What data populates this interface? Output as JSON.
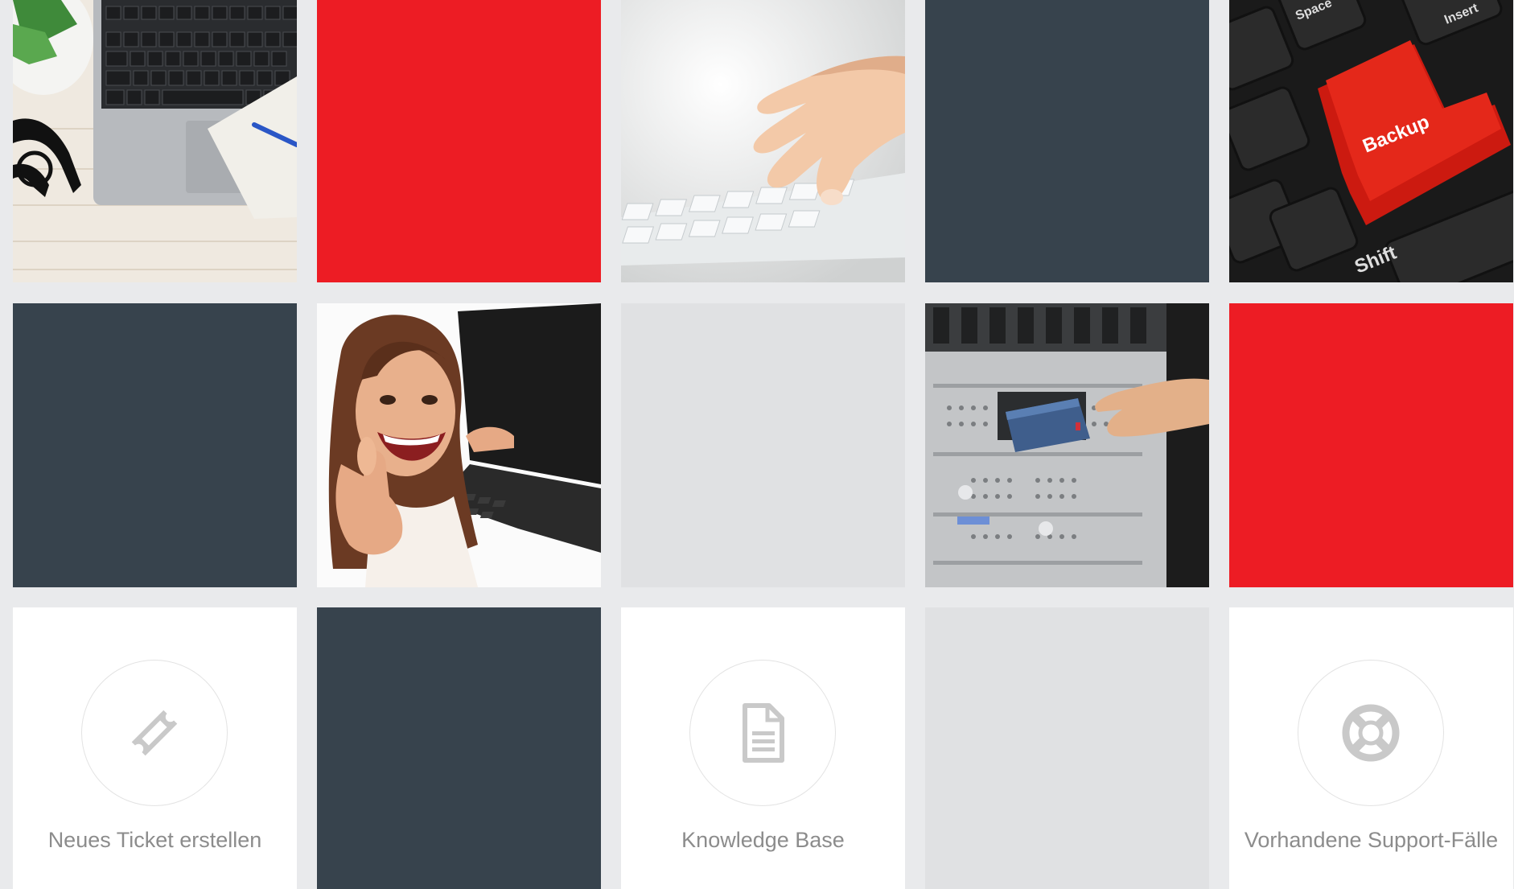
{
  "colors": {
    "page_background": "#e9eaec",
    "red": "#ed1c24",
    "dark": "#37434d",
    "light": "#e0e1e3",
    "white": "#ffffff",
    "label_gray": "#8c8c8c",
    "icon_gray": "#c9c9c9"
  },
  "tiles": {
    "photo_laptop_desk": {
      "kind": "photo",
      "subject": "laptop on wooden desk with plant, glasses and notepad"
    },
    "photo_hand_keyboard": {
      "kind": "photo",
      "subject": "hand typing on white keyboard"
    },
    "photo_backup_key": {
      "kind": "photo",
      "subject": "keyboard with red backup key",
      "key_text": "Backup",
      "shift_text": "Shift",
      "space_text": "Space",
      "insert_text": "Insert"
    },
    "photo_happy_user": {
      "kind": "photo",
      "subject": "smiling woman with laptop giving thumbs up"
    },
    "photo_server_rack": {
      "kind": "photo",
      "subject": "hand inserting tape cartridge into server rack"
    }
  },
  "actions": {
    "new_ticket": {
      "label": "Neues Ticket erstellen",
      "icon": "ticket-icon"
    },
    "knowledge_base": {
      "label": "Knowledge Base",
      "icon": "document-icon"
    },
    "support_cases": {
      "label": "Vorhandene Support-Fälle",
      "icon": "lifebuoy-icon"
    }
  }
}
